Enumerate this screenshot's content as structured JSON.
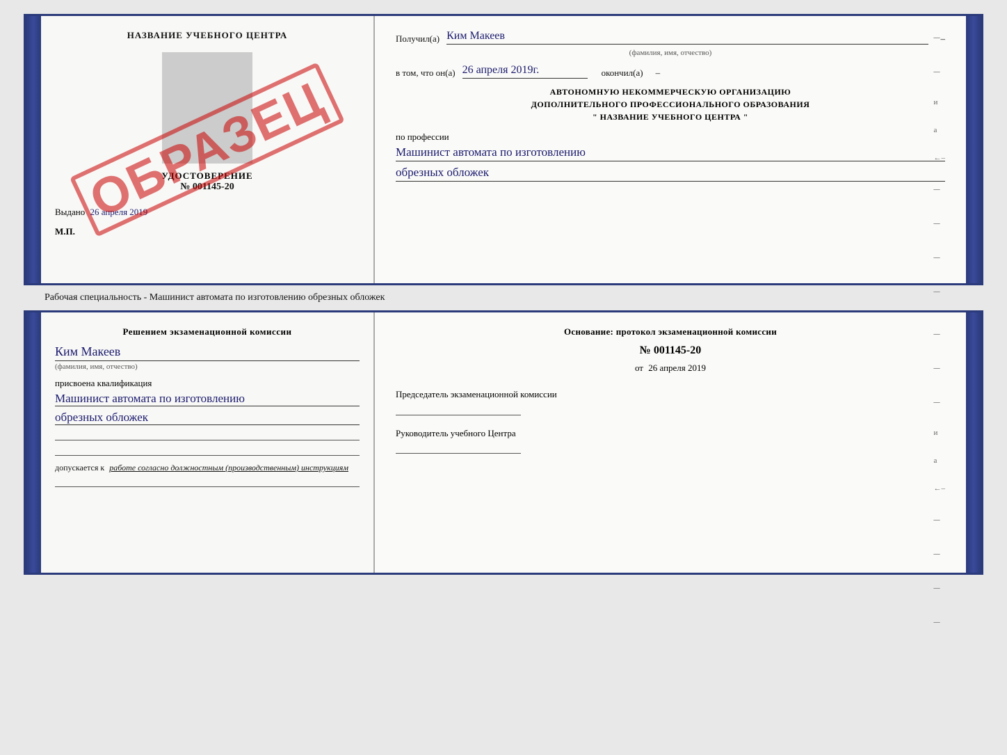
{
  "top": {
    "left": {
      "header": "НАЗВАНИЕ УЧЕБНОГО ЦЕНТРА",
      "stamp": "ОБРАЗЕЦ",
      "udost_label": "УДОСТОВЕРЕНИЕ",
      "udost_number": "№ 001145-20",
      "vydano_prefix": "Выдано",
      "vydano_date": "26 апреля 2019",
      "mp": "М.П."
    },
    "right": {
      "poluchil_label": "Получил(а)",
      "poluchil_value": "Ким Макеев",
      "fio_sub": "(фамилия, имя, отчество)",
      "vtom_label": "в том, что он(а)",
      "vtom_value": "26 апреля 2019г.",
      "okonchil": "окончил(а)",
      "org_line1": "АВТОНОМНУЮ НЕКОММЕРЧЕСКУЮ ОРГАНИЗАЦИЮ",
      "org_line2": "ДОПОЛНИТЕЛЬНОГО ПРОФЕССИОНАЛЬНОГО ОБРАЗОВАНИЯ",
      "org_line3": "\"   НАЗВАНИЕ УЧЕБНОГО ЦЕНТРА   \"",
      "profession_label": "по профессии",
      "profession_line1": "Машинист автомата по изготовлению",
      "profession_line2": "обрезных обложек"
    }
  },
  "separator": "Рабочая специальность - Машинист автомата по изготовлению обрезных обложек",
  "bottom": {
    "left": {
      "header": "Решением экзаменационной комиссии",
      "name": "Ким Макеев",
      "fio_sub": "(фамилия, имя, отчество)",
      "prisvoena_label": "присвоена квалификация",
      "qualification_line1": "Машинист автомата по изготовлению",
      "qualification_line2": "обрезных обложек",
      "dopusk_prefix": "допускается к",
      "dopusk_italic": "работе согласно должностным (производственным) инструкциям"
    },
    "right": {
      "osnov_label": "Основание: протокол экзаменационной комиссии",
      "protocol_number": "№ 001145-20",
      "date_prefix": "от",
      "date_value": "26 апреля 2019",
      "predsedatel_label": "Председатель экзаменационной комиссии",
      "rukovoditel_label": "Руководитель учебного Центра"
    }
  }
}
